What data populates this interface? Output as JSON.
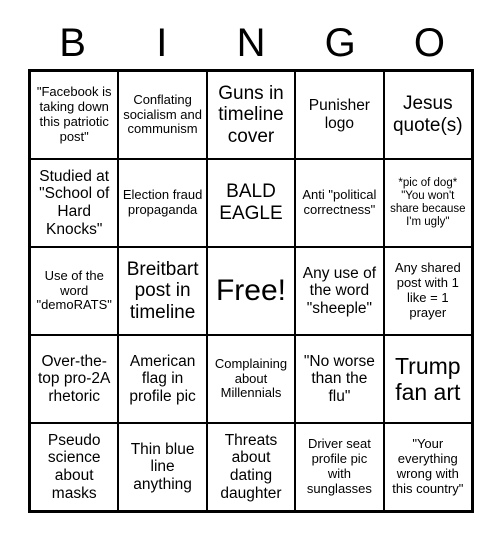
{
  "card": {
    "title": "BINGO",
    "header_letters": [
      "B",
      "I",
      "N",
      "G",
      "O"
    ],
    "columns": 5,
    "rows": 5,
    "colors": {
      "background": "#ffffff",
      "border": "#000000",
      "text": "#000000"
    },
    "cells": [
      {
        "text": "\"Facebook is taking down this patriotic post\"",
        "size": "s",
        "free": false
      },
      {
        "text": "Conflating socialism and communism",
        "size": "s",
        "free": false
      },
      {
        "text": "Guns in timeline cover",
        "size": "l",
        "free": false
      },
      {
        "text": "Punisher logo",
        "size": "m",
        "free": false
      },
      {
        "text": "Jesus quote(s)",
        "size": "l",
        "free": false
      },
      {
        "text": "Studied at \"School of Hard Knocks\"",
        "size": "m",
        "free": false
      },
      {
        "text": "Election fraud propaganda",
        "size": "s",
        "free": false
      },
      {
        "text": "BALD EAGLE",
        "size": "l",
        "free": false
      },
      {
        "text": "Anti \"political correctness\"",
        "size": "s",
        "free": false
      },
      {
        "text": "*pic of dog* \"You won't share because I'm ugly\"",
        "size": "xs",
        "free": false
      },
      {
        "text": "Use of the word \"demoRATS\"",
        "size": "s",
        "free": false
      },
      {
        "text": "Breitbart post in timeline",
        "size": "l",
        "free": false
      },
      {
        "text": "Free!",
        "size": "xxl",
        "free": true
      },
      {
        "text": "Any use of the word \"sheeple\"",
        "size": "m",
        "free": false
      },
      {
        "text": "Any shared post with 1 like = 1 prayer",
        "size": "s",
        "free": false
      },
      {
        "text": "Over-the-top pro-2A rhetoric",
        "size": "m",
        "free": false
      },
      {
        "text": "American flag in profile pic",
        "size": "m",
        "free": false
      },
      {
        "text": "Complaining about Millennials",
        "size": "s",
        "free": false
      },
      {
        "text": "\"No worse than the flu\"",
        "size": "m",
        "free": false
      },
      {
        "text": "Trump fan art",
        "size": "xl",
        "free": false
      },
      {
        "text": "Pseudo science about masks",
        "size": "m",
        "free": false
      },
      {
        "text": "Thin blue line anything",
        "size": "m",
        "free": false
      },
      {
        "text": "Threats about dating daughter",
        "size": "m",
        "free": false
      },
      {
        "text": "Driver seat profile pic with sunglasses",
        "size": "s",
        "free": false
      },
      {
        "text": "\"Your everything wrong with this country\"",
        "size": "s",
        "free": false
      }
    ]
  }
}
